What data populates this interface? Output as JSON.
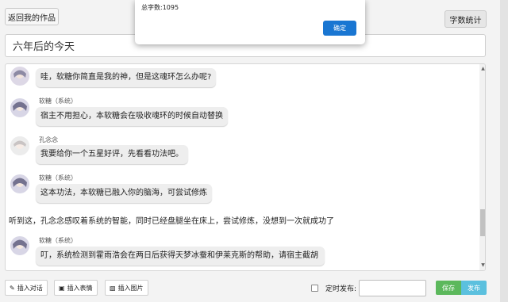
{
  "header": {
    "back_label": "返回我的作品",
    "count_label": "字数统计"
  },
  "title_value": "六年后的今天",
  "chat": {
    "messages": [
      {
        "type": "bubble",
        "sender": "",
        "text": "哇，软糖你简直是我的神，但是这魂环怎么办呢?"
      },
      {
        "type": "bubble",
        "sender": "软糖（系统）",
        "text": "宿主不用担心，本软糖会在吸收魂环的时候自动替换"
      },
      {
        "type": "bubble",
        "sender": "孔念念",
        "text": "我要给你一个五星好评，先看看功法吧。"
      },
      {
        "type": "bubble",
        "sender": "软糖（系统）",
        "text": "这本功法，本软糖已融入你的脑海，可尝试修炼"
      },
      {
        "type": "narration",
        "text": "听到这，孔念念感叹着系统的智能，同时已经盘腿坐在床上，尝试修炼，没想到一次就成功了"
      },
      {
        "type": "bubble",
        "sender": "软糖（系统）",
        "text": "叮，系统检测到霍雨浩会在两日后获得天梦冰蚕和伊莱克斯的帮助，请宿主截胡"
      }
    ]
  },
  "toolbar": {
    "insert_dialog": "插入对话",
    "insert_emoji": "插入表情",
    "insert_image": "插入图片",
    "timer_label": "定时发布:",
    "timer_value": "",
    "save_label": "保存",
    "publish_label": "发布"
  },
  "dialog": {
    "message": "总字数:1095",
    "ok_label": "确定"
  },
  "colors": {
    "save": "#5cb85c",
    "publish": "#5bc0de",
    "ok": "#1976d2"
  },
  "icons": [
    "chat-icon",
    "emoji-icon",
    "image-icon",
    "checkbox-icon"
  ]
}
